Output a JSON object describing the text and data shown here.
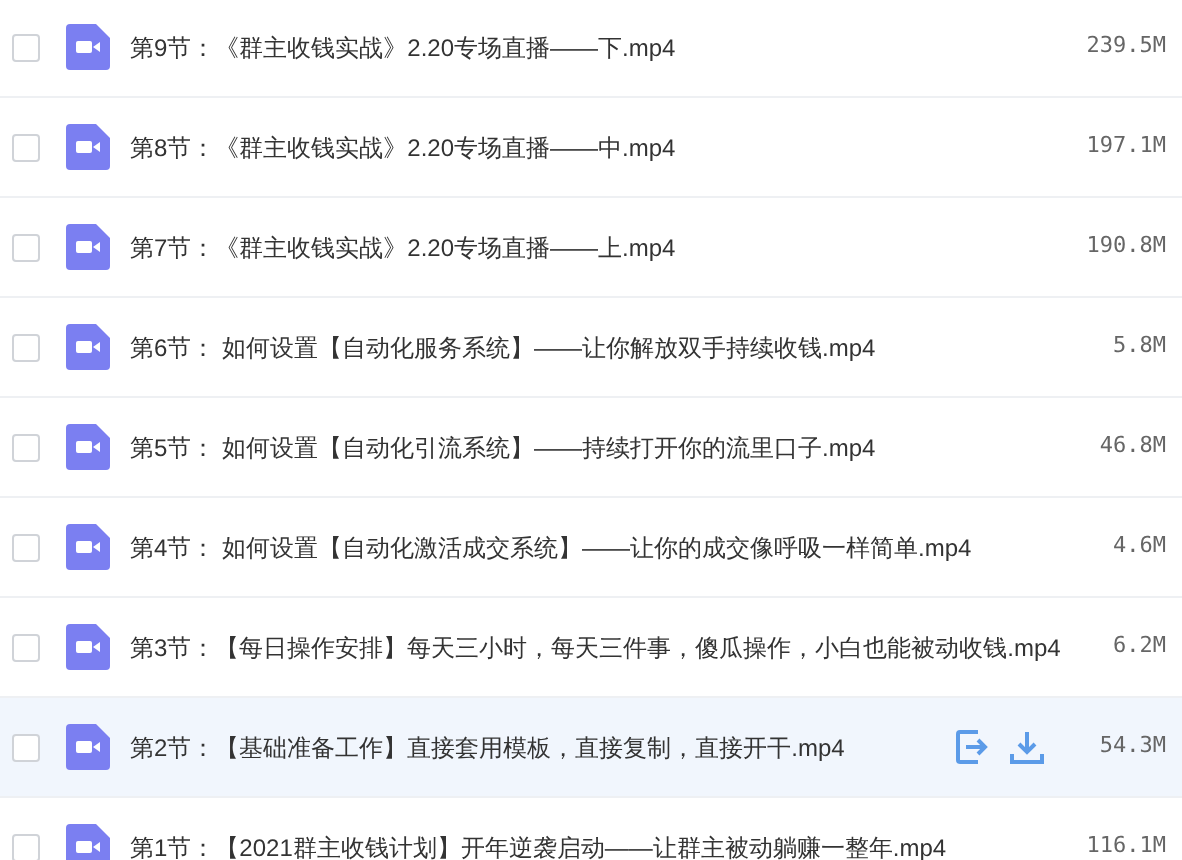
{
  "files": [
    {
      "name": "第9节：《群主收钱实战》2.20专场直播——下.mp4",
      "size": "239.5M",
      "checked": false,
      "highlighted": false
    },
    {
      "name": "第8节：《群主收钱实战》2.20专场直播——中.mp4",
      "size": "197.1M",
      "checked": false,
      "highlighted": false
    },
    {
      "name": "第7节：《群主收钱实战》2.20专场直播——上.mp4",
      "size": "190.8M",
      "checked": false,
      "highlighted": false
    },
    {
      "name": "第6节： 如何设置【自动化服务系统】——让你解放双手持续收钱.mp4",
      "size": "5.8M",
      "checked": false,
      "highlighted": false
    },
    {
      "name": "第5节： 如何设置【自动化引流系统】——持续打开你的流里口子.mp4",
      "size": "46.8M",
      "checked": false,
      "highlighted": false
    },
    {
      "name": "第4节： 如何设置【自动化激活成交系统】——让你的成交像呼吸一样简单.mp4",
      "size": "4.6M",
      "checked": false,
      "highlighted": false
    },
    {
      "name": "第3节：【每日操作安排】每天三小时，每天三件事，傻瓜操作，小白也能被动收钱.mp4",
      "size": "6.2M",
      "checked": false,
      "highlighted": false
    },
    {
      "name": "第2节：【基础准备工作】直接套用模板，直接复制，直接开干.mp4",
      "size": "54.3M",
      "checked": false,
      "highlighted": true
    },
    {
      "name": "第1节：【2021群主收钱计划】开年逆袭启动——让群主被动躺赚一整年.mp4",
      "size": "116.1M",
      "checked": false,
      "highlighted": false
    }
  ]
}
